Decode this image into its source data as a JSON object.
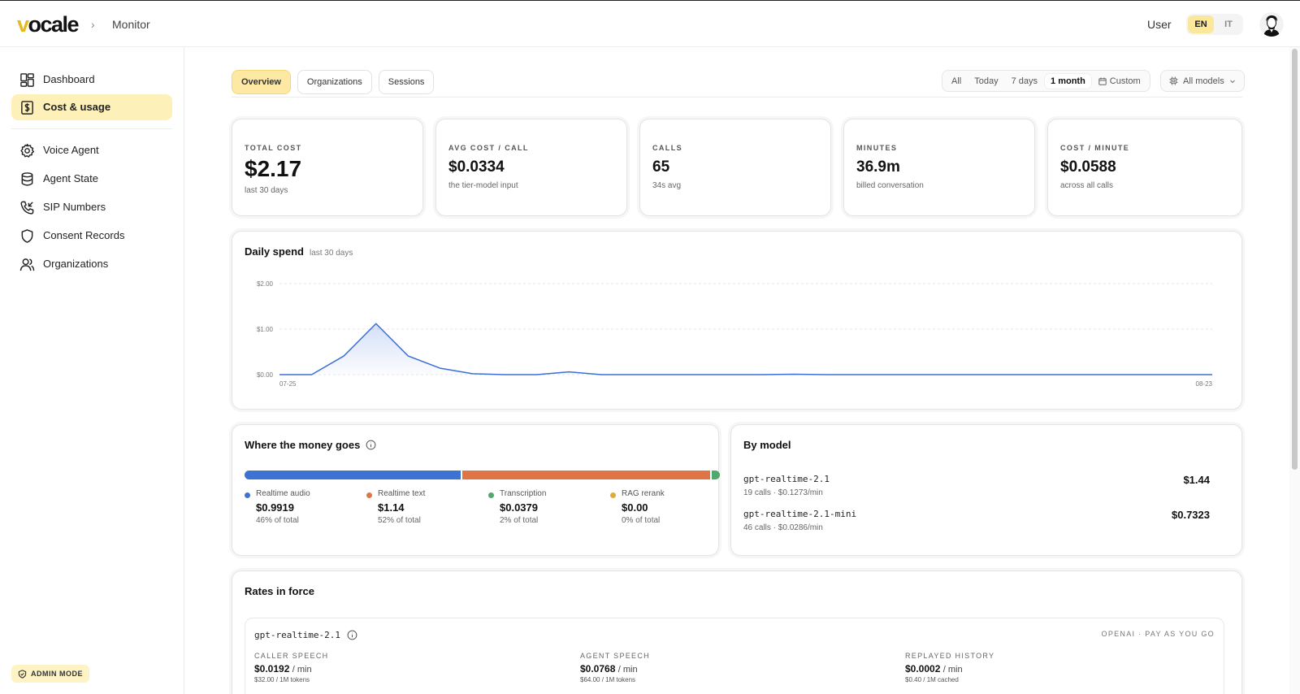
{
  "header": {
    "logo": "vocale",
    "breadcrumb_sep": "›",
    "breadcrumb": "Monitor",
    "user_label": "User",
    "languages": [
      "EN",
      "IT"
    ],
    "active_language": "EN"
  },
  "sidebar": {
    "items": [
      {
        "label": "Dashboard",
        "icon": "dashboard-icon"
      },
      {
        "label": "Cost & usage",
        "icon": "dollar-receipt-icon",
        "active": true
      },
      {
        "label": "Voice Agent",
        "icon": "gear-icon"
      },
      {
        "label": "Agent State",
        "icon": "database-icon"
      },
      {
        "label": "SIP Numbers",
        "icon": "phone-incoming-icon"
      },
      {
        "label": "Consent Records",
        "icon": "shield-icon"
      },
      {
        "label": "Organizations",
        "icon": "users-icon"
      }
    ],
    "admin_mode": "ADMIN MODE"
  },
  "tabs": [
    "Overview",
    "Organizations",
    "Sessions"
  ],
  "active_tab": "Overview",
  "range": {
    "options": [
      "All",
      "Today",
      "7 days",
      "1 month",
      "Custom"
    ],
    "active": "1 month"
  },
  "models_filter": "All models",
  "stats": [
    {
      "label": "TOTAL COST",
      "value": "$2.17",
      "sub": "last 30 days"
    },
    {
      "label": "AVG COST / CALL",
      "value": "$0.0334",
      "sub": "the tier-model input"
    },
    {
      "label": "CALLS",
      "value": "65",
      "sub": "34s avg"
    },
    {
      "label": "MINUTES",
      "value": "36.9m",
      "sub": "billed conversation"
    },
    {
      "label": "COST / MINUTE",
      "value": "$0.0588",
      "sub": "across all calls"
    }
  ],
  "daily_spend": {
    "title": "Daily spend",
    "subtitle": "last 30 days",
    "y_ticks": [
      "$2.00",
      "$1.00",
      "$0.00"
    ],
    "x_start": "07-25",
    "x_end": "08-23"
  },
  "chart_data": {
    "type": "area",
    "title": "Daily spend",
    "subtitle": "last 30 days",
    "x_start": "07-25",
    "x_end": "08-23",
    "ylim": [
      0,
      2
    ],
    "y_ticks": [
      "$2.00",
      "$1.00",
      "$0.00"
    ],
    "grid": true,
    "series": [
      {
        "values": [
          0,
          0,
          0.41,
          1.12,
          0.41,
          0.14,
          0.02,
          0,
          0,
          0.06,
          0,
          0,
          0,
          0,
          0,
          0,
          0.01,
          0,
          0,
          0,
          0,
          0,
          0,
          0,
          0,
          0,
          0,
          0,
          0,
          0
        ]
      }
    ],
    "color": "#3b6fd6"
  },
  "money": {
    "title": "Where the money goes",
    "segments": [
      {
        "name": "Realtime audio",
        "amount": "$0.9919",
        "pct_text": "46% of total",
        "share": 0.457,
        "color": "#3b72d3"
      },
      {
        "name": "Realtime text",
        "amount": "$1.14",
        "pct_text": "52% of total",
        "share": 0.525,
        "color": "#df7445"
      },
      {
        "name": "Transcription",
        "amount": "$0.0379",
        "pct_text": "2% of total",
        "share": 0.018,
        "color": "#4fa86c"
      },
      {
        "name": "RAG rerank",
        "amount": "$0.00",
        "pct_text": "0% of total",
        "share": 0,
        "color": "#e3a93a"
      }
    ]
  },
  "by_model": {
    "title": "By model",
    "rows": [
      {
        "name": "gpt-realtime-2.1",
        "meta": "19 calls · $0.1273/min",
        "cost": "$1.44"
      },
      {
        "name": "gpt-realtime-2.1-mini",
        "meta": "46 calls · $0.0286/min",
        "cost": "$0.7323"
      }
    ]
  },
  "rates": {
    "title": "Rates in force",
    "model": "gpt-realtime-2.1",
    "provider": "OPENAI · PAY AS YOU GO",
    "columns": [
      {
        "label": "CALLER SPEECH",
        "value": "$0.0192",
        "unit": "/ min",
        "sub": "$32.00 / 1M tokens"
      },
      {
        "label": "AGENT SPEECH",
        "value": "$0.0768",
        "unit": "/ min",
        "sub": "$64.00 / 1M tokens"
      },
      {
        "label": "REPLAYED HISTORY",
        "value": "$0.0002",
        "unit": "/ min",
        "sub": "$0.40 / 1M cached"
      }
    ]
  }
}
